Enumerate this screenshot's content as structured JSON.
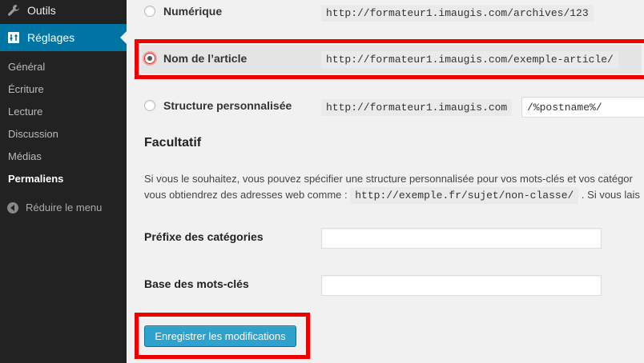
{
  "sidebar": {
    "outils_label": "Outils",
    "reglages_label": "Réglages",
    "items": [
      {
        "label": "Général"
      },
      {
        "label": "Écriture"
      },
      {
        "label": "Lecture"
      },
      {
        "label": "Discussion"
      },
      {
        "label": "Médias"
      },
      {
        "label": "Permaliens"
      }
    ],
    "collapse_label": "Réduire le menu"
  },
  "permalinks": {
    "options": [
      {
        "label": "Numérique",
        "example": "http://formateur1.imaugis.com/archives/123"
      },
      {
        "label": "Nom de l’article",
        "example": "http://formateur1.imaugis.com/exemple-article/"
      },
      {
        "label": "Structure personnalisée",
        "example": "http://formateur1.imaugis.com"
      }
    ],
    "custom_structure_value": "/%postname%/"
  },
  "optional": {
    "heading": "Facultatif",
    "line1": "Si vous le souhaitez, vous pouvez spécifier une structure personnalisée pour vos mots-clés et vos catégor",
    "line2_prefix": "vous obtiendrez des adresses web comme : ",
    "line2_code": "http://exemple.fr/sujet/non-classe/",
    "line2_suffix": ". Si vous lais",
    "category_base_label": "Préfixe des catégories",
    "tag_base_label": "Base des mots-clés"
  },
  "save_button": "Enregistrer les modifications",
  "colors": {
    "sidebar_bg": "#222222",
    "active_menu": "#0074a2",
    "button": "#2ea2cc",
    "highlight_box": "#e00000"
  }
}
